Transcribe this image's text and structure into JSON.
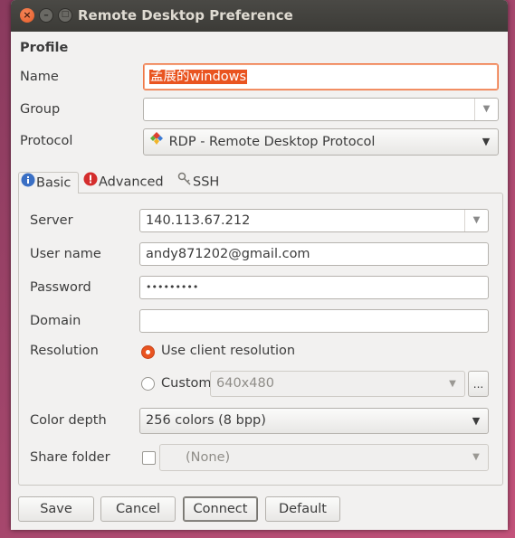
{
  "window": {
    "title": "Remote Desktop Preference"
  },
  "profile": {
    "section_title": "Profile",
    "name_label": "Name",
    "name_value": "孟展的windows",
    "group_label": "Group",
    "group_value": "",
    "protocol_label": "Protocol",
    "protocol_value": "RDP - Remote Desktop Protocol"
  },
  "tabs": [
    {
      "label": "Basic",
      "icon": "info-icon",
      "active": true
    },
    {
      "label": "Advanced",
      "icon": "warning-icon",
      "active": false
    },
    {
      "label": "SSH",
      "icon": "key-icon",
      "active": false
    }
  ],
  "basic": {
    "server_label": "Server",
    "server_value": "140.113.67.212",
    "username_label": "User name",
    "username_value": "andy871202@gmail.com",
    "password_label": "Password",
    "password_value": "•••••••••",
    "domain_label": "Domain",
    "domain_value": "",
    "resolution_label": "Resolution",
    "resolution_option_client": "Use client resolution",
    "resolution_option_custom": "Custom",
    "custom_resolution_value": "640x480",
    "custom_more_button": "...",
    "color_depth_label": "Color depth",
    "color_depth_value": "256 colors (8 bpp)",
    "share_folder_label": "Share folder",
    "share_folder_value": "(None)"
  },
  "buttons": {
    "save": "Save",
    "cancel": "Cancel",
    "connect": "Connect",
    "default": "Default"
  },
  "colors": {
    "accent": "#e95420",
    "titlebar": "#3c3b37",
    "window_bg": "#f2f1f0"
  }
}
